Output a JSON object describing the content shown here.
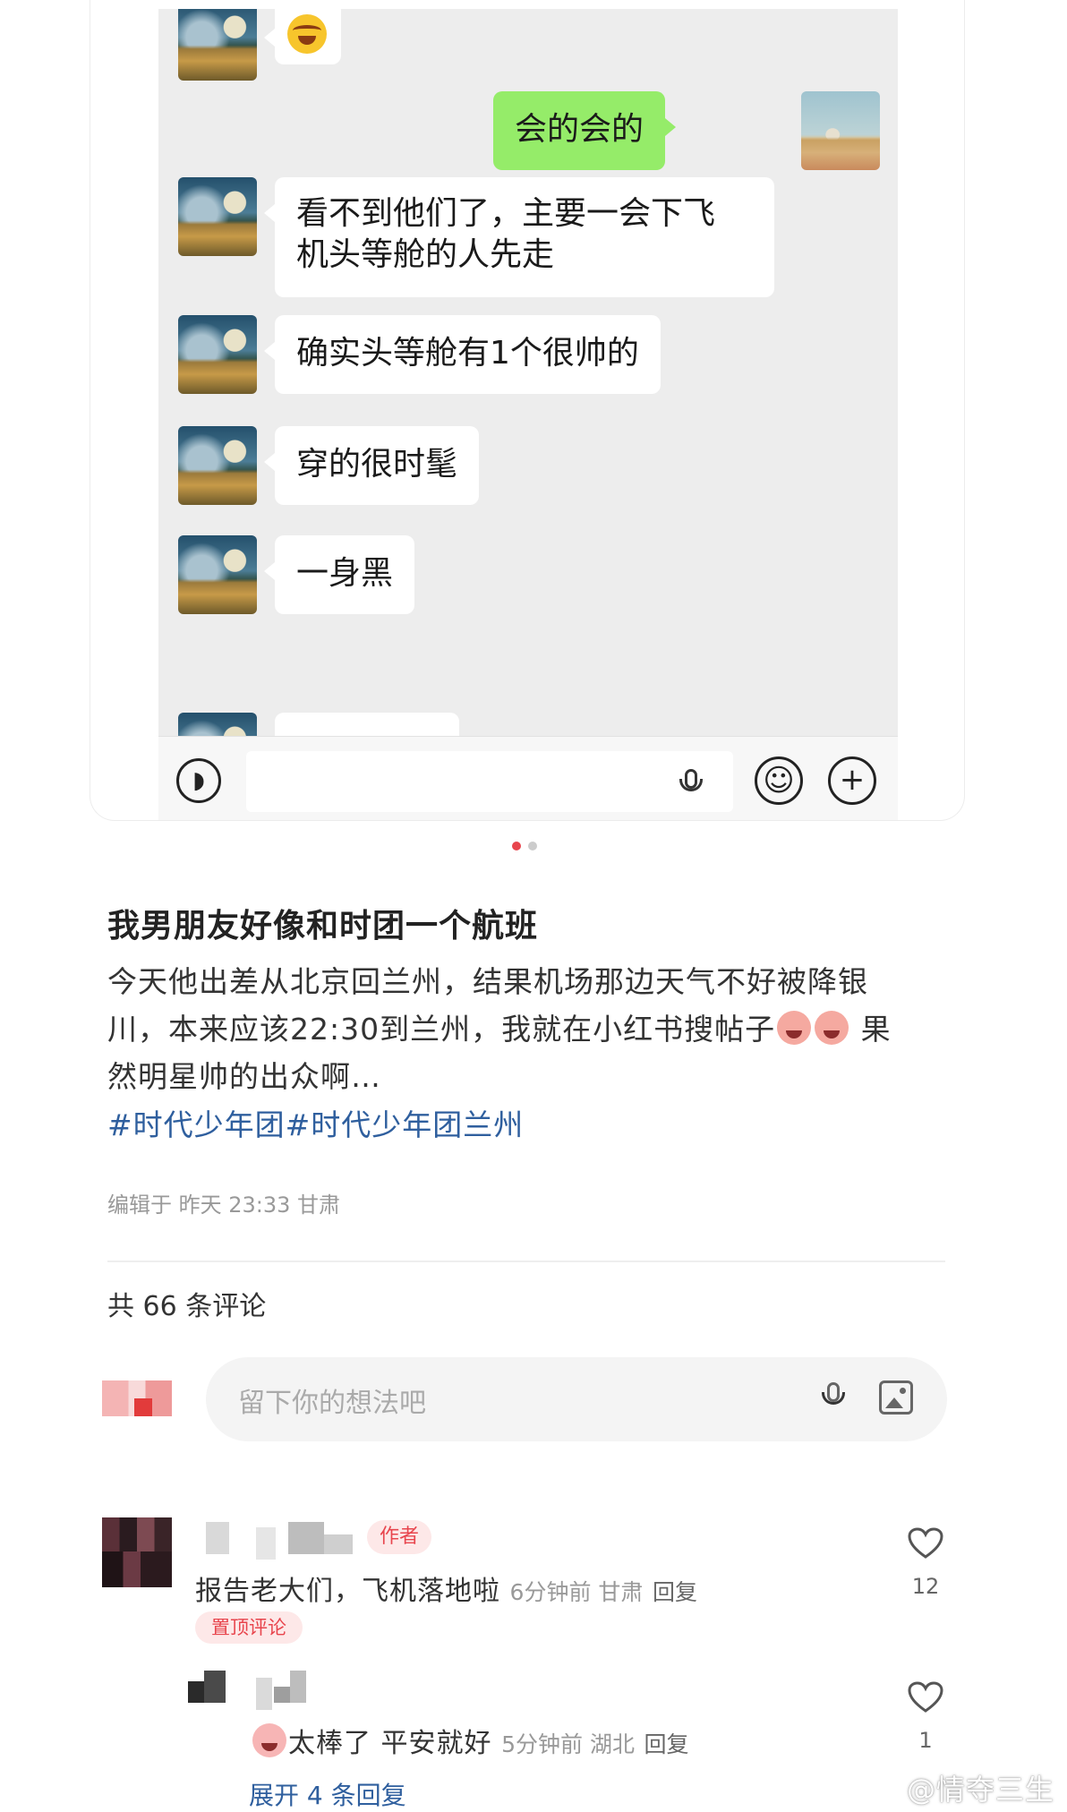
{
  "chat": {
    "messages": [
      {
        "side": "left",
        "text": ""
      },
      {
        "side": "right",
        "text": "会的会的"
      },
      {
        "side": "left",
        "text_line1": "看不到他们了，主要一会下飞",
        "text_line2": "机头等舱的人先走"
      },
      {
        "side": "left",
        "text": "确实头等舱有1个很帅的"
      },
      {
        "side": "left",
        "text": "穿的很时髦"
      },
      {
        "side": "left",
        "text": "一身黑"
      }
    ],
    "first_message_emoji": "face-with-tears-of-joy-icon",
    "inputbar": {
      "voice_icon": "voice-icon",
      "mic_icon": "microphone-icon",
      "emoji_icon": "smile-icon",
      "plus_icon": "plus-icon"
    }
  },
  "carousel": {
    "active_index": 0,
    "count": 2,
    "active_color": "#e8454d",
    "inactive_color": "#cccccc"
  },
  "post": {
    "title": "我男朋友好像和时团一个航班",
    "body_line1": "今天他出差从北京回兰州，结果机场那边天气不好被降银",
    "body_line2_pre": "川，本来应该22:30到兰州，我就在小红书搜帖子",
    "body_line2_post": "果",
    "body_line3": "然明星帅的出众啊…",
    "hashtags": "#时代少年团#时代少年团兰州",
    "meta": "编辑于 昨天 23:33 甘肃"
  },
  "comments_section": {
    "count_label": "共 66 条评论",
    "input_placeholder": "留下你的想法吧",
    "comments": [
      {
        "author_tag": "作者",
        "text": "报告老大们，飞机落地啦",
        "time": "6分钟前 甘肃",
        "reply": "回复",
        "pinned_label": "置顶评论",
        "likes": "12"
      },
      {
        "text": "太棒了 平安就好",
        "time": "5分钟前 湖北",
        "reply": "回复",
        "likes": "1"
      }
    ],
    "expand_label": "展开 4 条回复"
  },
  "watermark": "@情夺三生",
  "colors": {
    "accent_red": "#e8454d",
    "link_blue": "#2f5f9e",
    "wechat_green": "#95ec69"
  }
}
